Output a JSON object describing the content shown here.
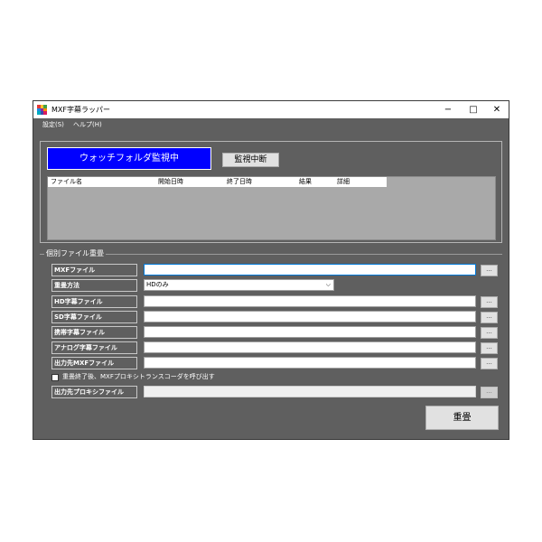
{
  "window": {
    "title": "MXF字幕ラッパー",
    "minimize": "−",
    "maximize": "□",
    "close": "✕"
  },
  "menu": {
    "settings": "設定(S)",
    "help": "ヘルプ(H)"
  },
  "watch": {
    "status": "ウォッチフォルダ監視中",
    "stop_button": "監視中断",
    "columns": [
      "ファイル名",
      "開始日時",
      "終了日時",
      "結果",
      "詳細"
    ]
  },
  "individual": {
    "group_label": "個別ファイル重畳",
    "mxf_label": "MXFファイル",
    "mxf_value": "",
    "method_label": "重畳方法",
    "method_value": "HDのみ",
    "hd_label": "HD字幕ファイル",
    "sd_label": "SD字幕ファイル",
    "mobile_label": "携帯字幕ファイル",
    "analog_label": "アナログ字幕ファイル",
    "output_label": "出力先MXFファイル",
    "transcode_check_label": "重畳終了後、MXFプロキシトランスコーダを呼び出す",
    "proxy_label": "出力先プロキシファイル",
    "browse": "...",
    "submit_button": "重畳"
  },
  "colors": {
    "window_bg": "#5f5f5f",
    "status_bg": "#0000ff",
    "list_bg": "#a9a9a9"
  },
  "icons": {
    "app": "colorful-grid-icon",
    "dropdown": "chevron-down-icon"
  }
}
